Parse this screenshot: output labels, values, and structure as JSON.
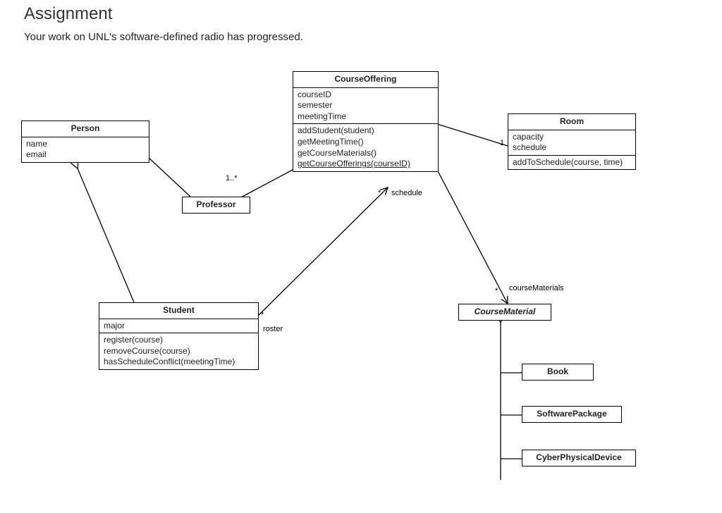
{
  "header": {
    "title": "Assignment",
    "intro": "Your work on UNL's software-defined radio has progressed."
  },
  "classes": {
    "person": {
      "name": "Person",
      "attributes": [
        "name",
        "email"
      ]
    },
    "professor": {
      "name": "Professor"
    },
    "student": {
      "name": "Student",
      "attributes": [
        "major"
      ],
      "operations": [
        "register(course)",
        "removeCourse(course)",
        "hasScheduleConflict(meetingTime)"
      ]
    },
    "courseOffering": {
      "name": "CourseOffering",
      "attributes": [
        "courseID",
        "semester",
        "meetingTime"
      ],
      "operations": [
        "addStudent(student)",
        "getMeetingTime()",
        "getCourseMaterials()",
        "getCourseOfferings(courseID)"
      ]
    },
    "room": {
      "name": "Room",
      "attributes": [
        "capacity",
        "schedule"
      ],
      "operations": [
        "addToSchedule(course, time)"
      ]
    },
    "courseMaterial": {
      "name": "CourseMaterial"
    },
    "book": {
      "name": "Book"
    },
    "softwarePackage": {
      "name": "SoftwarePackage"
    },
    "cyberPhysicalDevice": {
      "name": "CyberPhysicalDevice"
    }
  },
  "labels": {
    "profMult": "1..*",
    "roomMult": "1",
    "roster": "roster",
    "rosterMult": "*",
    "schedule": "schedule",
    "scheduleMult": "*",
    "courseMaterials": "courseMaterials",
    "courseMaterialsMult": "*"
  }
}
